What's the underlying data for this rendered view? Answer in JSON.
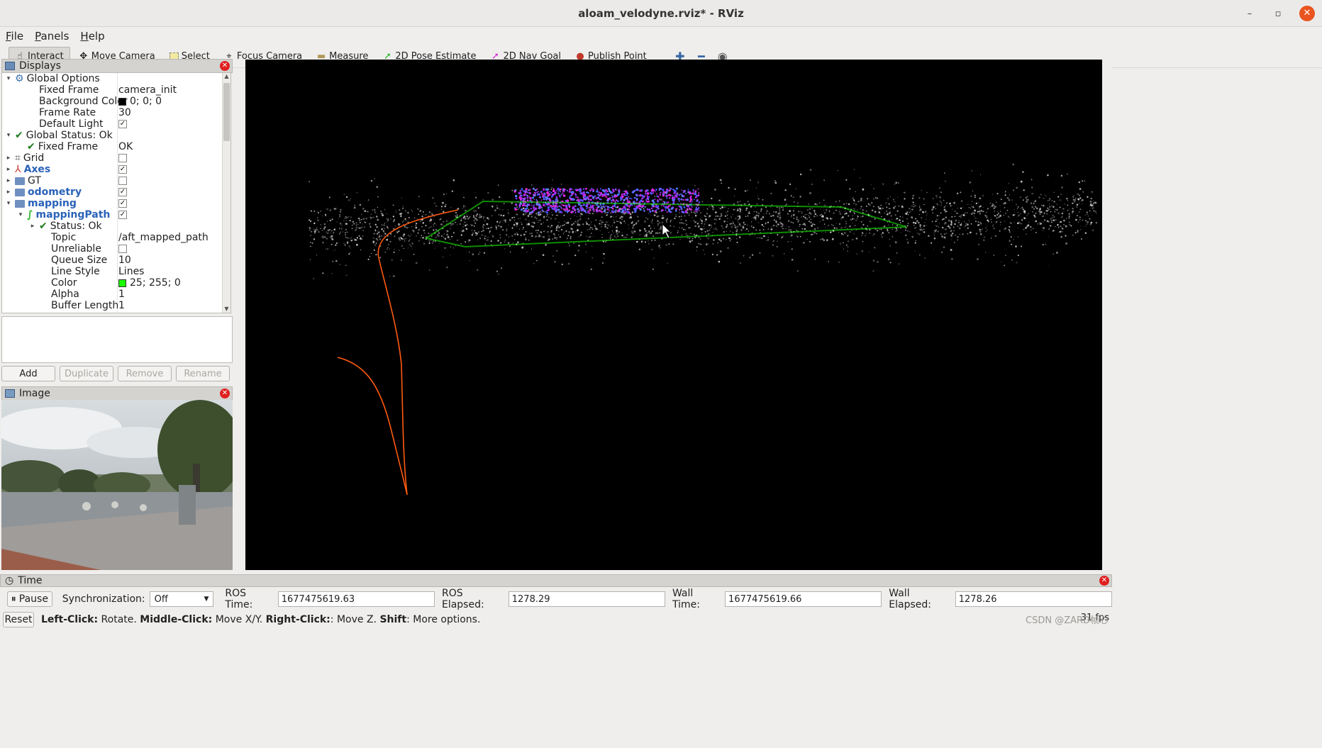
{
  "window": {
    "title": "aloam_velodyne.rviz* - RViz",
    "min": "–",
    "restore": "▫",
    "close": "✕"
  },
  "menu": [
    "File",
    "Panels",
    "Help"
  ],
  "toolbar": [
    {
      "label": "Interact",
      "icon": "cursor-icon",
      "glyph": "☝"
    },
    {
      "label": "Move Camera",
      "icon": "move-camera-icon",
      "glyph": "✥"
    },
    {
      "label": "Select",
      "icon": "select-icon",
      "glyph": "▭"
    },
    {
      "label": "Focus Camera",
      "icon": "focus-camera-icon",
      "glyph": "⌖"
    },
    {
      "label": "Measure",
      "icon": "ruler-icon",
      "glyph": "▬"
    },
    {
      "label": "2D Pose Estimate",
      "icon": "pose-arrow-icon",
      "glyph": "➚"
    },
    {
      "label": "2D Nav Goal",
      "icon": "nav-goal-arrow-icon",
      "glyph": "➚"
    },
    {
      "label": "Publish Point",
      "icon": "map-pin-icon",
      "glyph": "📍"
    }
  ],
  "toolbar_extra": {
    "add": "✚",
    "remove": "━",
    "view": "◉"
  },
  "displays": {
    "title": "Displays",
    "rows": [
      {
        "indent": 0,
        "arrow": "▾",
        "icon": "gear",
        "key": "Global Options",
        "value": ""
      },
      {
        "indent": 2,
        "arrow": "",
        "icon": "",
        "key": "Fixed Frame",
        "value": "camera_init"
      },
      {
        "indent": 2,
        "arrow": "",
        "icon": "",
        "key": "Background Color",
        "value": "0; 0; 0",
        "swatch": "#000000"
      },
      {
        "indent": 2,
        "arrow": "",
        "icon": "",
        "key": "Frame Rate",
        "value": "30"
      },
      {
        "indent": 2,
        "arrow": "",
        "icon": "",
        "key": "Default Light",
        "value": "",
        "check": true
      },
      {
        "indent": 0,
        "arrow": "▾",
        "icon": "check",
        "key": "Global Status: Ok",
        "value": ""
      },
      {
        "indent": 1,
        "arrow": "",
        "icon": "check",
        "key": "Fixed Frame",
        "value": "OK"
      },
      {
        "indent": 0,
        "arrow": "▸",
        "icon": "grid",
        "key": "Grid",
        "value": "",
        "check": false
      },
      {
        "indent": 0,
        "arrow": "▸",
        "icon": "axes",
        "key": "Axes",
        "value": "",
        "check": true,
        "blue": true
      },
      {
        "indent": 0,
        "arrow": "▸",
        "icon": "folder",
        "key": "GT",
        "value": "",
        "check": false
      },
      {
        "indent": 0,
        "arrow": "▸",
        "icon": "folder",
        "key": "odometry",
        "value": "",
        "check": true,
        "blue": true
      },
      {
        "indent": 0,
        "arrow": "▾",
        "icon": "folder",
        "key": "mapping",
        "value": "",
        "check": true,
        "blue": true
      },
      {
        "indent": 1,
        "arrow": "▾",
        "icon": "path",
        "key": "mappingPath",
        "value": "",
        "check": true,
        "blue": true
      },
      {
        "indent": 2,
        "arrow": "▸",
        "icon": "check",
        "key": "Status: Ok",
        "value": ""
      },
      {
        "indent": 3,
        "arrow": "",
        "icon": "",
        "key": "Topic",
        "value": "/aft_mapped_path"
      },
      {
        "indent": 3,
        "arrow": "",
        "icon": "",
        "key": "Unreliable",
        "value": "",
        "check": false
      },
      {
        "indent": 3,
        "arrow": "",
        "icon": "",
        "key": "Queue Size",
        "value": "10"
      },
      {
        "indent": 3,
        "arrow": "",
        "icon": "",
        "key": "Line Style",
        "value": "Lines"
      },
      {
        "indent": 3,
        "arrow": "",
        "icon": "",
        "key": "Color",
        "value": "25; 255; 0",
        "swatch": "#19ff00"
      },
      {
        "indent": 3,
        "arrow": "",
        "icon": "",
        "key": "Alpha",
        "value": "1"
      },
      {
        "indent": 3,
        "arrow": "",
        "icon": "",
        "key": "Buffer Length",
        "value": "1"
      }
    ],
    "buttons": {
      "add": "Add",
      "duplicate": "Duplicate",
      "remove": "Remove",
      "rename": "Rename"
    }
  },
  "image_panel": {
    "title": "Image"
  },
  "time_panel": {
    "title": "Time",
    "pause": "Pause",
    "sync_label": "Synchronization:",
    "sync_value": "Off",
    "ros_time_label": "ROS Time:",
    "ros_time": "1677475619.63",
    "ros_elapsed_label": "ROS Elapsed:",
    "ros_elapsed": "1278.29",
    "wall_time_label": "Wall Time:",
    "wall_time": "1677475619.66",
    "wall_elapsed_label": "Wall Elapsed:",
    "wall_elapsed": "1278.26"
  },
  "status": {
    "reset": "Reset",
    "h1": "Left-Click:",
    "t1": " Rotate. ",
    "h2": "Middle-Click:",
    "t2": " Move X/Y. ",
    "h3": "Right-Click:",
    "t3": ": Move Z. ",
    "h4": "Shift",
    "t4": ": More options.",
    "fps": "31 fps",
    "watermark": "CSDN @ZARD帧心"
  },
  "colors": {
    "path": "#19ff00",
    "trajectory": "#ff5a10",
    "background": "#000000"
  }
}
